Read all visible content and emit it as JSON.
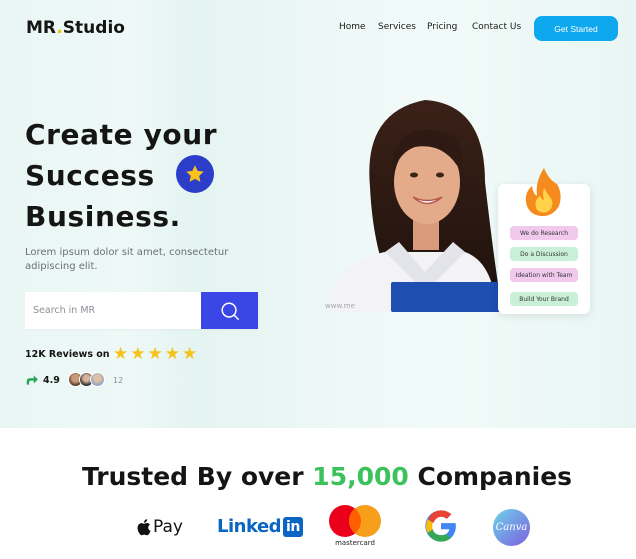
{
  "brand": {
    "name_prefix": "MR",
    "name_dot": ".",
    "name_suffix": "Studio"
  },
  "nav": {
    "items": [
      "Home",
      "Services",
      "Pricing",
      "Contact Us"
    ],
    "cta_label": "Get Started"
  },
  "hero": {
    "headline_line1": "Create your",
    "headline_line2": "Success",
    "headline_line3": "Business.",
    "subtitle": "Lorem ipsum dolor sit amet, consectetur adipiscing elit.",
    "search_placeholder": "Search in MR",
    "reviews_label": "12K Reviews on",
    "stars": 5,
    "rating": "4.9",
    "avatar_count": "12",
    "badge_icon": "star-icon"
  },
  "task_card": {
    "items": [
      "We do Research",
      "Do a Discussion",
      "Ideation with Team",
      "Build Your Brand"
    ]
  },
  "trusted": {
    "prefix": "Trusted By over ",
    "highlight": "15,000",
    "suffix": " Companies",
    "highlight_color": "#3bc25a"
  },
  "partner_logos": {
    "apple_pay": "Pay",
    "linkedin_a": "Linked",
    "linkedin_b": "in",
    "mastercard": "mastercard",
    "canva": "Canva"
  },
  "colors": {
    "accent": "#0ea8ef",
    "search_button": "#3b46e6",
    "star": "#f7c21d",
    "badge": "#2c3ec9"
  }
}
